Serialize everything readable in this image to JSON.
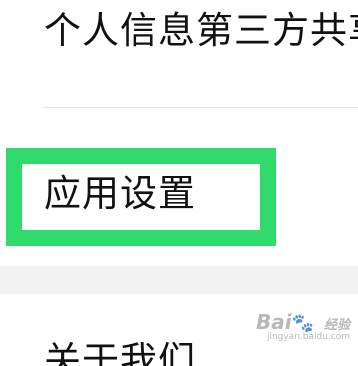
{
  "settings": {
    "items": [
      {
        "label": "个人信息第三方共享清单"
      },
      {
        "label": "应用设置"
      },
      {
        "label": "关于我们"
      }
    ]
  },
  "highlight": {
    "color": "#2fdc6b",
    "target": "应用设置"
  },
  "watermark": {
    "logo": "Bai",
    "logo_suffix": "经验",
    "url": "jingyan.baidu.com"
  }
}
